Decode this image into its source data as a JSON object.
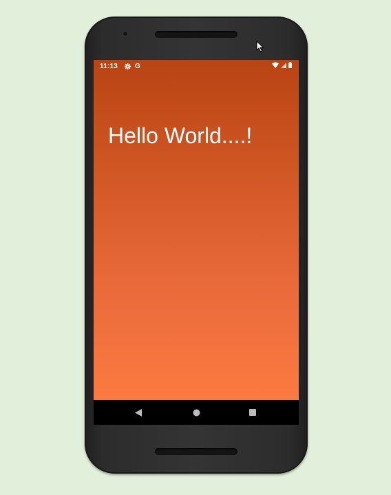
{
  "status_bar": {
    "time": "11:13",
    "icons": [
      "settings-gear-icon",
      "google-g-icon",
      "wifi-icon",
      "cellular-signal-icon",
      "battery-icon"
    ],
    "google_letter": "G"
  },
  "app": {
    "greeting": "Hello World....!",
    "gradient_top": "#b94413",
    "gradient_bottom": "#fc7a41"
  },
  "nav_bar": {
    "buttons": [
      "back-icon",
      "home-icon",
      "recents-icon"
    ]
  },
  "colors": {
    "page_background": "#e2efda",
    "device_body": "#343434",
    "text": "#ffffff"
  }
}
